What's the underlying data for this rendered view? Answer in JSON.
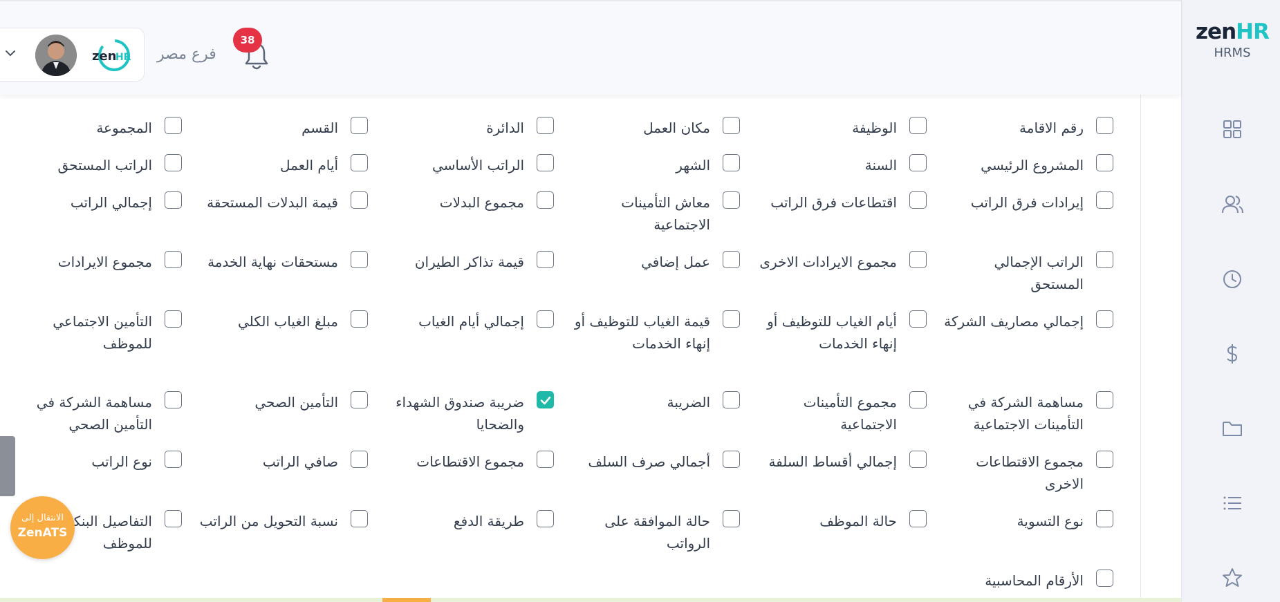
{
  "header": {
    "branch": "فرع مصر",
    "notifications_count": "38",
    "user_logo_text": "zenHR"
  },
  "sidebar": {
    "brand_main": "zen",
    "brand_accent": "HR",
    "brand_sub": "HRMS",
    "nav": [
      "dashboard-icon",
      "users-icon",
      "clock-icon",
      "dollar-icon",
      "folder-icon",
      "list-icon",
      "star-icon"
    ]
  },
  "ats_button": {
    "line1": "الانتقال إلى",
    "line2": "ZenATS"
  },
  "colors": {
    "accent": "#1fb9aa",
    "badge": "#e53345",
    "ats": "#f8ad45"
  },
  "columns": {
    "rows": [
      [
        "رقم الاقامة",
        "الوظيفة",
        "مكان العمل",
        "الدائرة",
        "القسم",
        "المجموعة"
      ],
      [
        "المشروع الرئيسي",
        "السنة",
        "الشهر",
        "الراتب الأساسي",
        "أيام العمل",
        "الراتب المستحق"
      ],
      [
        "إيرادات فرق الراتب",
        "اقتطاعات فرق الراتب",
        "معاش التأمينات الاجتماعية",
        "مجموع البدلات",
        "قيمة البدلات المستحقة",
        "إجمالي الراتب"
      ],
      [
        "الراتب الإجمالي المستحق",
        "مجموع الايرادات الاخرى",
        "عمل إضافي",
        "قيمة تذاكر الطيران",
        "مستحقات نهاية الخدمة",
        "مجموع الايرادات"
      ],
      [
        "إجمالي مصاريف الشركة",
        "أيام الغياب للتوظيف أو إنهاء الخدمات",
        "قيمة الغياب للتوظيف أو إنهاء الخدمات",
        "إجمالي أيام الغياب",
        "مبلغ الغياب الكلي",
        "التأمين الاجتماعي للموظف"
      ],
      [
        "مساهمة الشركة في التأمينات الاجتماعية",
        "مجموع التأمينات الاجتماعية",
        "الضريبة",
        "ضريبة صندوق الشهداء والضحايا",
        "التأمين الصحي",
        "مساهمة الشركة في التأمين الصحي"
      ],
      [
        "مجموع الاقتطاعات الاخرى",
        "إجمالي أقساط السلفة",
        "أجمالي صرف السلف",
        "مجموع الاقتطاعات",
        "صافي الراتب",
        "نوع الراتب"
      ],
      [
        "نوع التسوية",
        "حالة الموظف",
        "حالة الموافقة على الرواتب",
        "طريقة الدفع",
        "نسبة التحويل من الراتب",
        "التفاصيل البنكية للموظف"
      ],
      [
        "الأرقام المحاسبية"
      ]
    ],
    "checked": [
      [
        5,
        3
      ]
    ]
  }
}
